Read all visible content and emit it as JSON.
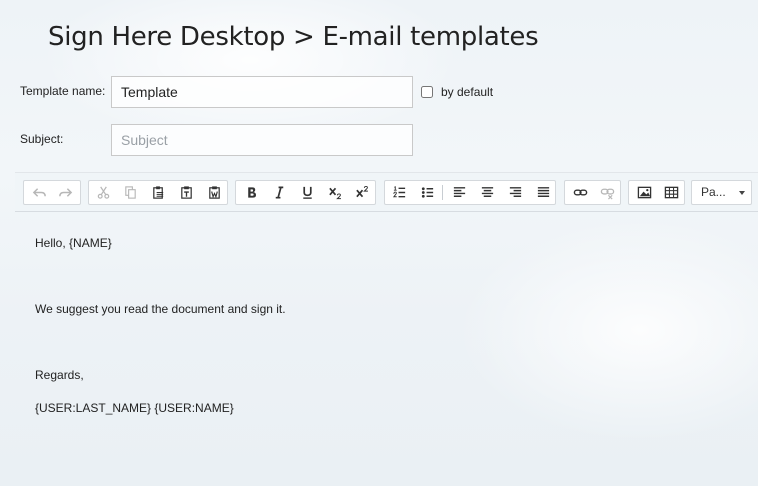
{
  "page": {
    "title": "Sign Here Desktop > E-mail templates"
  },
  "form": {
    "template_name_label": "Template name:",
    "template_name_value": "Template",
    "by_default_label": "by default",
    "subject_label": "Subject:",
    "subject_placeholder": "Subject",
    "subject_value": ""
  },
  "toolbar": {
    "groups": [
      {
        "name": "history",
        "buttons": [
          "undo-icon",
          "redo-icon"
        ],
        "state": "disabled"
      },
      {
        "name": "clipboard",
        "buttons": [
          "cut-icon",
          "copy-icon",
          "paste-icon",
          "paste-text-icon",
          "paste-word-icon"
        ]
      },
      {
        "name": "basic-styles",
        "buttons": [
          "bold-icon",
          "italic-icon",
          "underline-icon",
          "subscript-icon",
          "superscript-icon"
        ]
      },
      {
        "name": "paragraph",
        "buttons": [
          "numbered-list-icon",
          "bulleted-list-icon",
          "align-left-icon",
          "align-center-icon",
          "align-right-icon",
          "justify-icon"
        ]
      },
      {
        "name": "links",
        "buttons": [
          "link-icon",
          "unlink-icon"
        ]
      },
      {
        "name": "insert",
        "buttons": [
          "image-icon",
          "table-icon"
        ]
      }
    ],
    "format_value": "Pa..."
  },
  "editor": {
    "lines": [
      "Hello, {NAME}",
      "We suggest you read the document and sign it.",
      "Regards,",
      "{USER:LAST_NAME} {USER:NAME}"
    ]
  }
}
